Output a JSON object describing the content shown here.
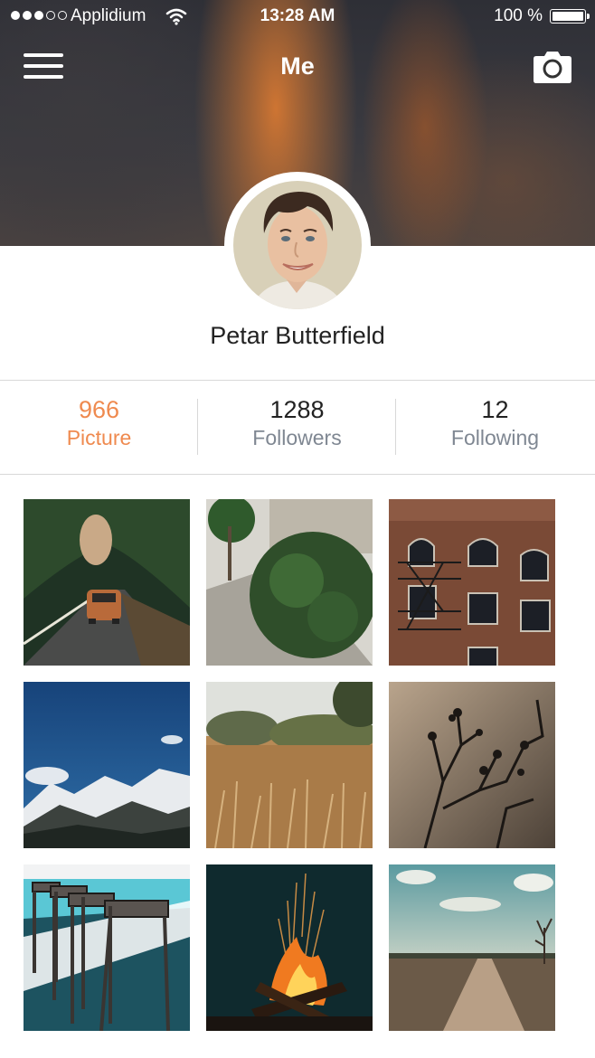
{
  "status_bar": {
    "carrier": "Applidium",
    "time": "13:28 AM",
    "battery": "100 %",
    "signal_bars_filled": 3,
    "signal_bars_total": 5
  },
  "nav": {
    "title": "Me",
    "menu_icon": "hamburger-menu-icon",
    "camera_icon": "camera-icon"
  },
  "profile": {
    "name": "Petar Butterfield"
  },
  "stats": [
    {
      "value": "966",
      "label": "Picture",
      "active": true
    },
    {
      "value": "1288",
      "label": "Followers",
      "active": false
    },
    {
      "value": "12",
      "label": "Following",
      "active": false
    }
  ],
  "colors": {
    "accent": "#ef8a4f",
    "stat_label": "#7f8792",
    "divider": "#d8d8d8"
  }
}
